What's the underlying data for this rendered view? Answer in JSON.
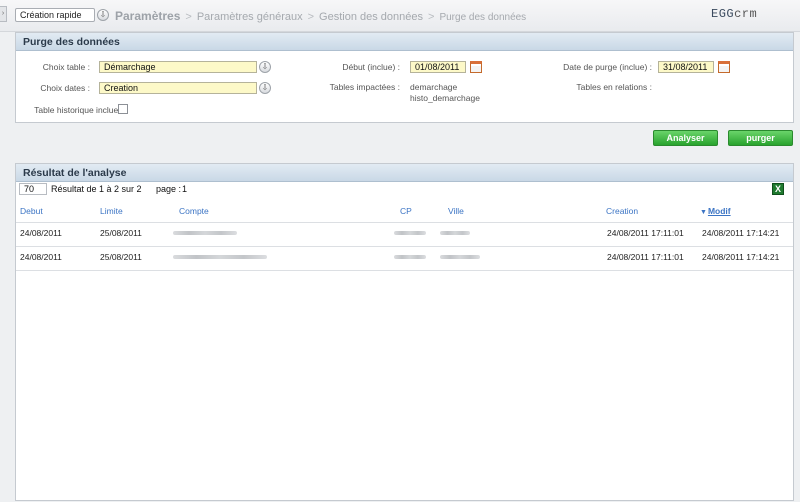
{
  "topbar": {
    "quick_create": "Création rapide",
    "breadcrumb": [
      "Paramètres",
      "Paramètres généraux",
      "Gestion des données",
      "Purge des données"
    ],
    "separator": ">",
    "logo_main": "EGG",
    "logo_suffix": "crm"
  },
  "purge": {
    "title": "Purge des données",
    "choix_table_label": "Choix table :",
    "choix_table_value": "Démarchage",
    "choix_dates_label": "Choix dates :",
    "choix_dates_value": "Creation",
    "historique_label": "Table historique inclue :",
    "debut_label": "Début (inclue) :",
    "debut_value": "01/08/2011",
    "tables_impactees_label": "Tables impactées :",
    "tables_impactees": [
      "demarchage",
      "histo_demarchage"
    ],
    "date_purge_label": "Date de purge (inclue) :",
    "date_purge_value": "31/08/2011",
    "tables_relations_label": "Tables en relations :"
  },
  "actions": {
    "analyser": "Analyser",
    "purger": "purger"
  },
  "result": {
    "title": "Résultat de l'analyse",
    "page_size": "70",
    "summary": "Résultat de 1 à 2 sur 2",
    "page_label": "page :",
    "page_value": "1",
    "columns": {
      "debut": "Debut",
      "limite": "Limite",
      "compte": "Compte",
      "cp": "CP",
      "ville": "Ville",
      "creation": "Creation",
      "modif": "Modif"
    },
    "rows": [
      {
        "debut": "24/08/2011",
        "limite": "25/08/2011",
        "creation": "24/08/2011 17:11:01",
        "modif": "24/08/2011 17:14:21"
      },
      {
        "debut": "24/08/2011",
        "limite": "25/08/2011",
        "creation": "24/08/2011 17:11:01",
        "modif": "24/08/2011 17:14:21"
      }
    ]
  },
  "icons": {
    "dropdown": "chevron-down-icon",
    "calendar": "calendar-icon",
    "excel_export": "excel-icon",
    "sort": "sort-desc-icon"
  }
}
